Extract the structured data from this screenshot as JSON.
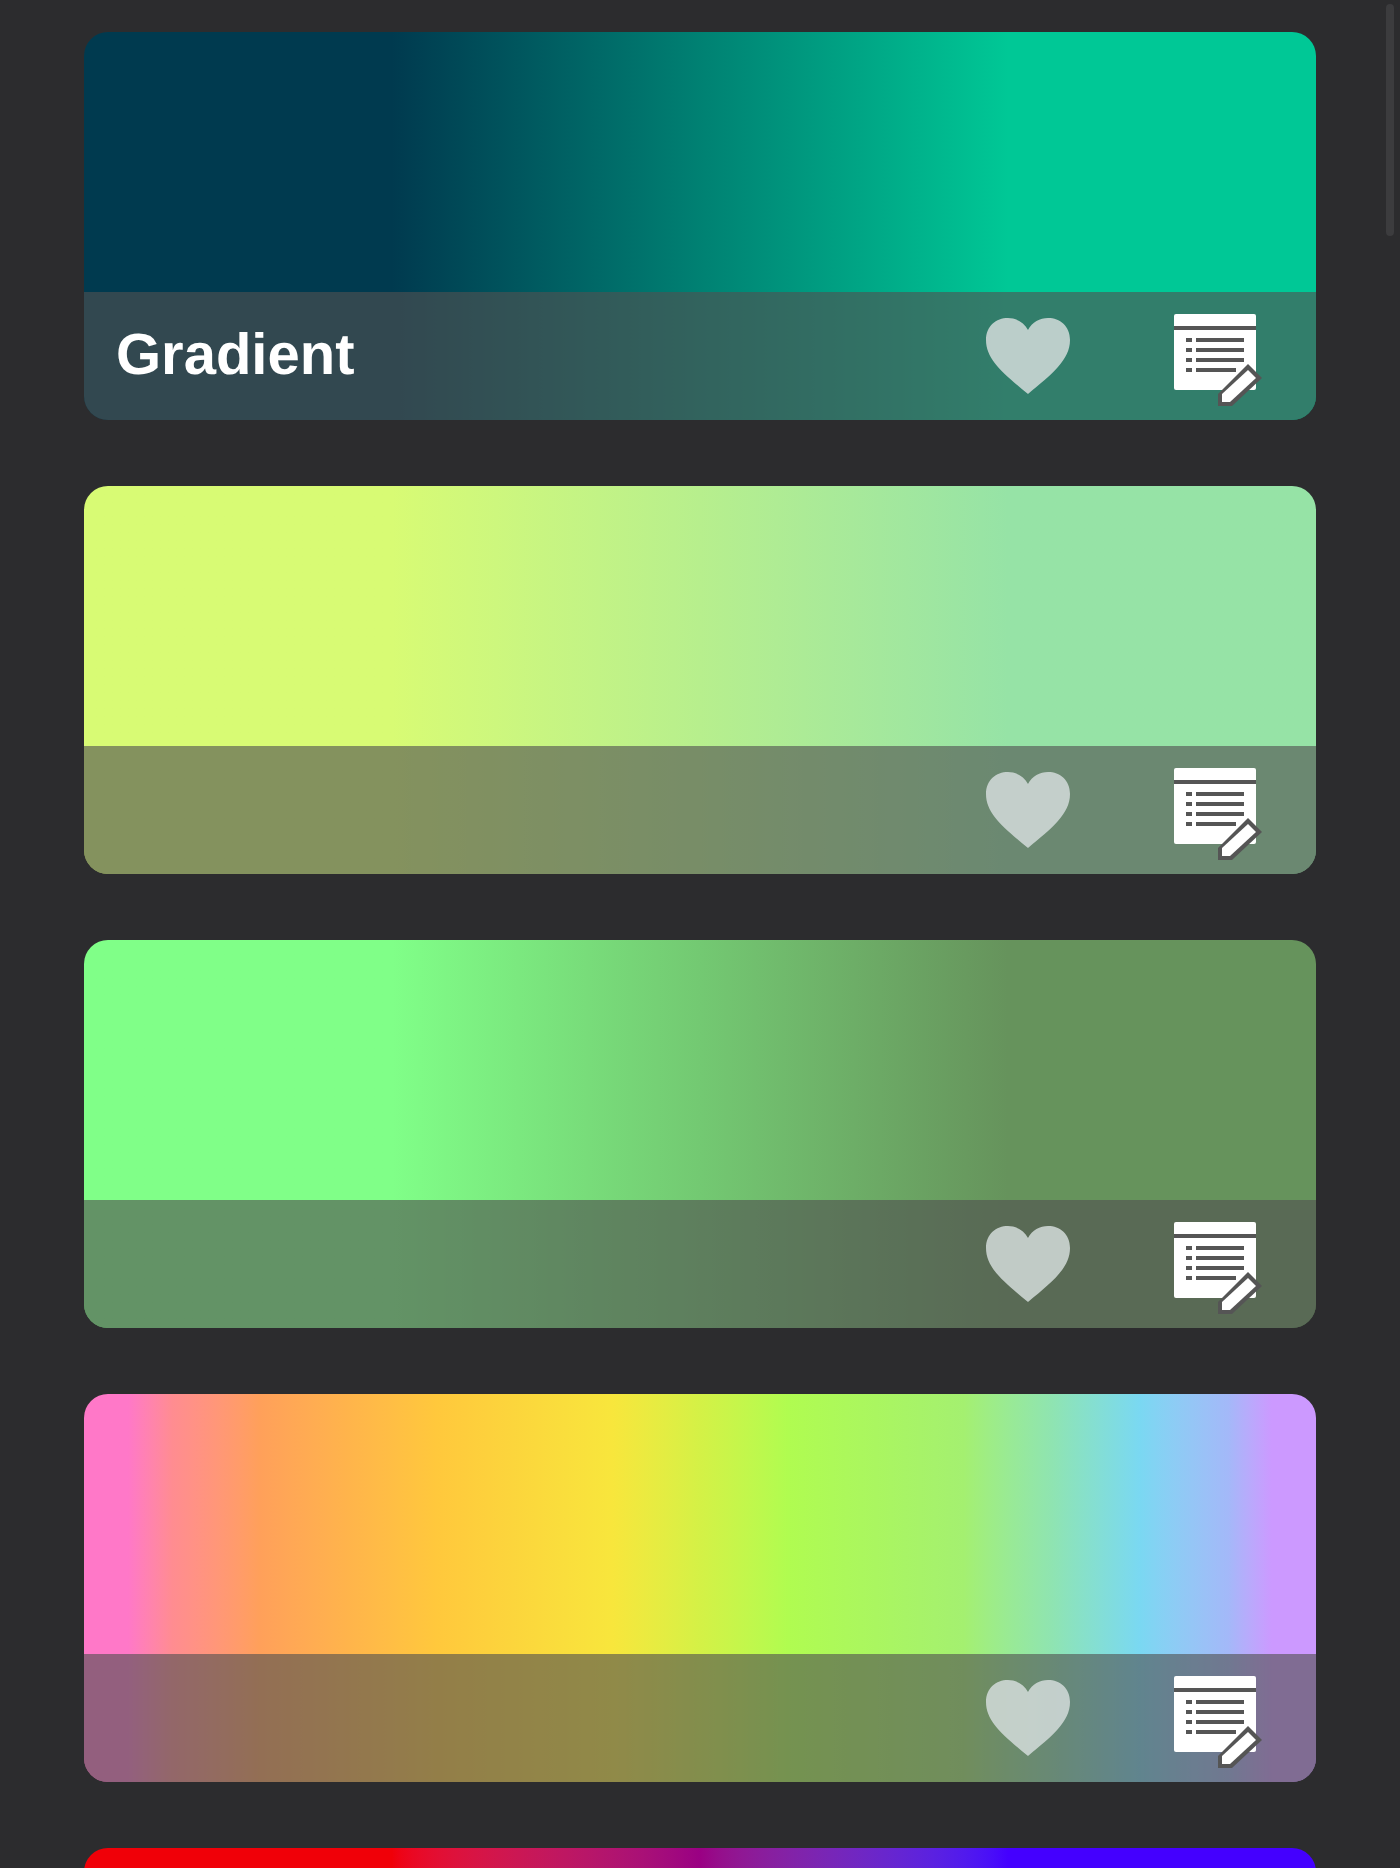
{
  "cards": [
    {
      "title": "Gradient",
      "footer": true,
      "stops": [
        {
          "color": "#003a4f"
        },
        {
          "color": "#00c896"
        }
      ]
    },
    {
      "footer": true,
      "stops": [
        {
          "color": "#d8fb74"
        },
        {
          "color": "#96e3a6"
        }
      ]
    },
    {
      "footer": true,
      "stops": [
        {
          "color": "#80ff88"
        },
        {
          "color": "#66935c"
        }
      ]
    },
    {
      "footer": true,
      "stops": [
        {
          "color": "#ff78c8"
        },
        {
          "color": "#ffa05a"
        },
        {
          "color": "#ffc83c"
        },
        {
          "color": "#f8e63c"
        },
        {
          "color": "#b0fc50"
        },
        {
          "color": "#a4f070"
        },
        {
          "color": "#7ad8f2"
        },
        {
          "color": "#cc99ff"
        }
      ]
    },
    {
      "footer": false,
      "stops": [
        {
          "color": "#f00008"
        },
        {
          "color": "#4400ff"
        }
      ]
    }
  ]
}
